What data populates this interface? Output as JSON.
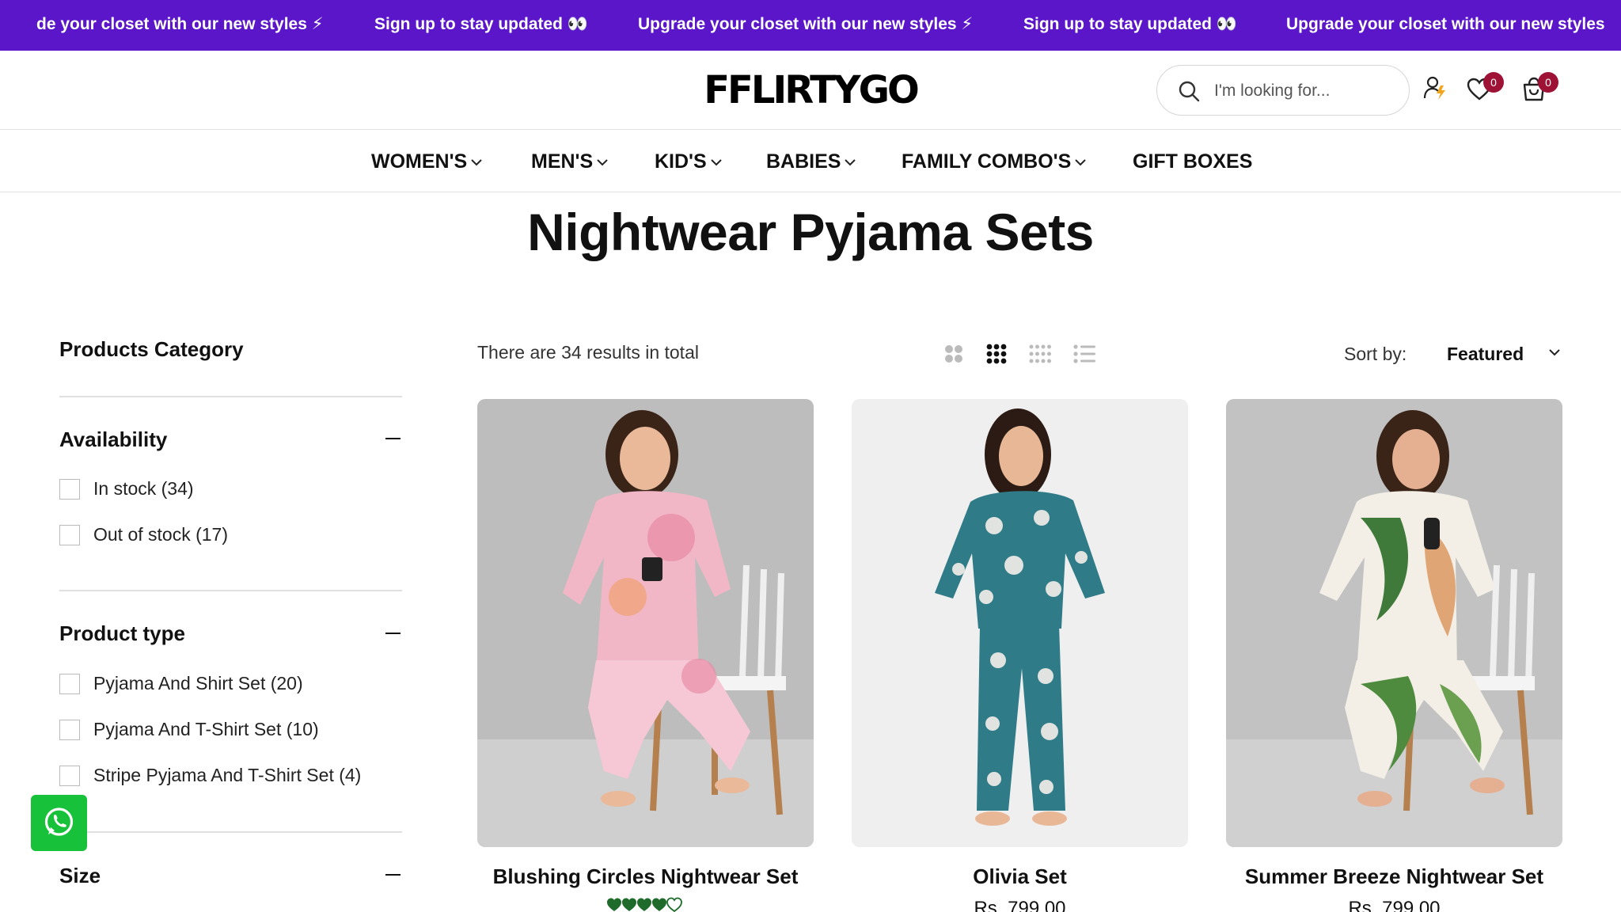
{
  "announcement": {
    "items": [
      "de your closet with our new styles ⚡",
      "Sign up to stay updated 👀",
      "Upgrade your closet with our new styles ⚡",
      "Sign up to stay updated 👀",
      "Upgrade your closet with our new styles"
    ]
  },
  "header": {
    "logo": "FFLIRTYGO",
    "search_placeholder": "I'm looking for...",
    "wishlist_count": "0",
    "cart_count": "0"
  },
  "nav": {
    "items": [
      "WOMEN'S",
      "MEN'S",
      "KID'S",
      "BABIES",
      "FAMILY COMBO'S",
      "GIFT BOXES"
    ]
  },
  "page": {
    "title": "Nightwear Pyjama Sets"
  },
  "sidebar": {
    "category_heading": "Products Category",
    "availability": {
      "heading": "Availability",
      "options": [
        "In stock (34)",
        "Out of stock (17)"
      ]
    },
    "product_type": {
      "heading": "Product type",
      "options": [
        "Pyjama And Shirt Set (20)",
        "Pyjama And T-Shirt Set (10)",
        "Stripe Pyjama And T-Shirt Set (4)"
      ]
    },
    "size": {
      "heading": "Size"
    }
  },
  "toolbar": {
    "results_text": "There are 34 results in total",
    "sort_label": "Sort by:",
    "sort_value": "Featured",
    "active_grid": "3-column"
  },
  "products": [
    {
      "title": "Blushing Circles Nightwear Set",
      "rating_stars": 4,
      "rating_max": 5
    },
    {
      "title": "Olivia Set",
      "price": "Rs. 799.00"
    },
    {
      "title": "Summer Breeze Nightwear Set",
      "price": "Rs. 799.00"
    }
  ],
  "colors": {
    "announcement_bg": "#5b16c9",
    "badge": "#9e1236",
    "whatsapp": "#18c13a",
    "stars": "#1e6b2b"
  }
}
